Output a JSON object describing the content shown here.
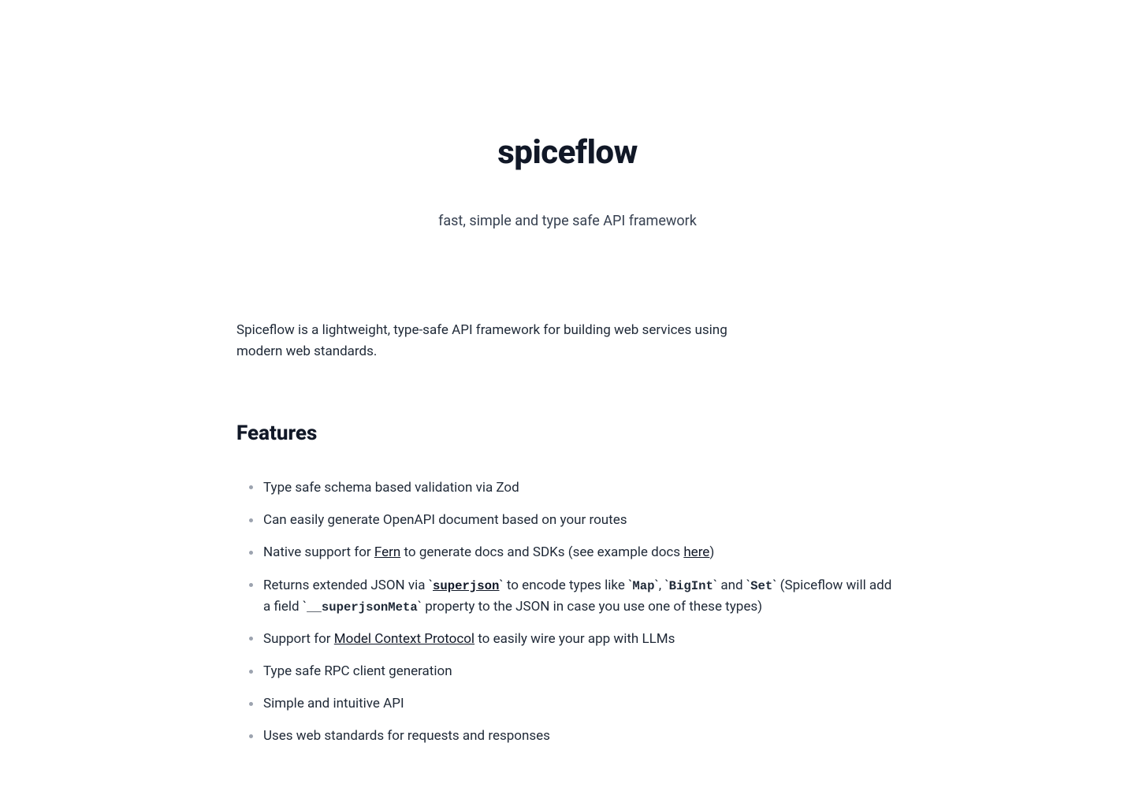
{
  "hero": {
    "title": "spiceflow",
    "tagline": "fast, simple and type safe API framework"
  },
  "intro": "Spiceflow is a lightweight, type-safe API framework for building web services using modern web standards.",
  "features": {
    "heading": "Features",
    "items": {
      "f1": "Type safe schema based validation via Zod",
      "f2": "Can easily generate OpenAPI document based on your routes",
      "f3_prefix": "Native support for ",
      "f3_link1": "Fern",
      "f3_mid": " to generate docs and SDKs (see example docs ",
      "f3_link2": "here",
      "f3_suffix": ")",
      "f4_prefix": "Returns extended JSON via ",
      "f4_code1_tick_open": "`",
      "f4_code1": "superjson",
      "f4_code1_tick_close": "`",
      "f4_mid1": " to encode types like ",
      "f4_tick": "`",
      "f4_map": "Map",
      "f4_comma": ", ",
      "f4_bigint": "BigInt",
      "f4_and": " and ",
      "f4_set": "Set",
      "f4_mid2": " (Spiceflow will add a field ",
      "f4_meta": "__superjsonMeta",
      "f4_suffix": " property to the JSON in case you use one of these types)",
      "f5_prefix": "Support for ",
      "f5_link": "Model Context Protocol",
      "f5_suffix": " to easily wire your app with LLMs",
      "f6": "Type safe RPC client generation",
      "f7": "Simple and intuitive API",
      "f8": "Uses web standards for requests and responses"
    }
  }
}
